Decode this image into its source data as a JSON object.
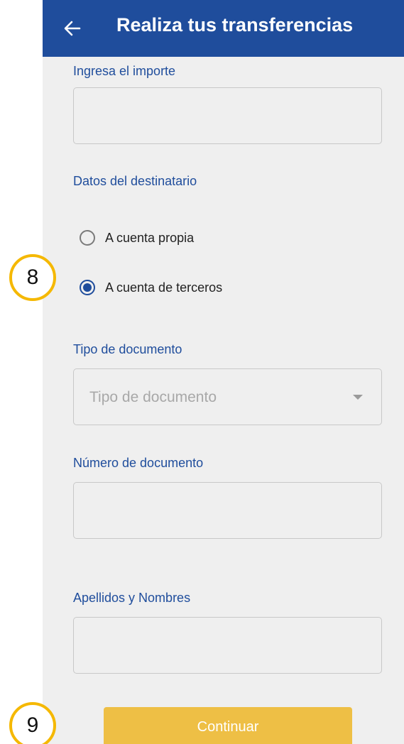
{
  "header": {
    "back_icon": "arrow-left-icon",
    "title": "Realiza tus transferencias"
  },
  "amount": {
    "label": "Ingresa el importe",
    "value": "",
    "placeholder": ""
  },
  "recipient": {
    "section_label": "Datos del destinatario",
    "options": [
      {
        "label": "A cuenta propia",
        "selected": false
      },
      {
        "label": "A cuenta de terceros",
        "selected": true
      }
    ]
  },
  "document_type": {
    "label": "Tipo de documento",
    "placeholder": "Tipo de documento"
  },
  "document_number": {
    "label": "Número de documento",
    "value": ""
  },
  "full_name": {
    "label": "Apellidos y Nombres",
    "value": ""
  },
  "actions": {
    "continue_label": "Continuar"
  },
  "annotations": {
    "marker_8": "8",
    "marker_9": "9"
  },
  "colors": {
    "brand_blue": "#1f4d9c",
    "button_yellow": "#eebf45",
    "annotation_ring": "#f5b800",
    "background": "#efefef"
  }
}
